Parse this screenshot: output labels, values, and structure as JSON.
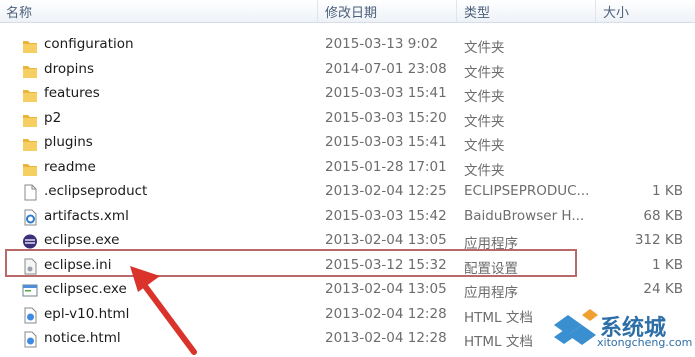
{
  "columns": {
    "name": "名称",
    "date": "修改日期",
    "type": "类型",
    "size": "大小"
  },
  "files": [
    {
      "name": "configuration",
      "date": "2015-03-13 9:02",
      "type": "文件夹",
      "size": "",
      "icon": "folder-icon"
    },
    {
      "name": "dropins",
      "date": "2014-07-01 23:08",
      "type": "文件夹",
      "size": "",
      "icon": "folder-icon"
    },
    {
      "name": "features",
      "date": "2015-03-03 15:41",
      "type": "文件夹",
      "size": "",
      "icon": "folder-icon"
    },
    {
      "name": "p2",
      "date": "2015-03-03 15:20",
      "type": "文件夹",
      "size": "",
      "icon": "folder-icon"
    },
    {
      "name": "plugins",
      "date": "2015-03-03 15:41",
      "type": "文件夹",
      "size": "",
      "icon": "folder-icon"
    },
    {
      "name": "readme",
      "date": "2015-01-28 17:01",
      "type": "文件夹",
      "size": "",
      "icon": "folder-icon"
    },
    {
      "name": ".eclipseproduct",
      "date": "2013-02-04 12:25",
      "type": "ECLIPSEPRODUC...",
      "size": "1 KB",
      "icon": "file-icon"
    },
    {
      "name": "artifacts.xml",
      "date": "2015-03-03 15:42",
      "type": "BaiduBrowser H...",
      "size": "68 KB",
      "icon": "xml-file-icon"
    },
    {
      "name": "eclipse.exe",
      "date": "2013-02-04 13:05",
      "type": "应用程序",
      "size": "312 KB",
      "icon": "eclipse-app-icon"
    },
    {
      "name": "eclipse.ini",
      "date": "2015-03-12 15:32",
      "type": "配置设置",
      "size": "1 KB",
      "icon": "ini-file-icon"
    },
    {
      "name": "eclipsec.exe",
      "date": "2013-02-04 13:05",
      "type": "应用程序",
      "size": "24 KB",
      "icon": "exe-file-icon"
    },
    {
      "name": "epl-v10.html",
      "date": "2013-02-04 12:28",
      "type": "HTML 文档",
      "size": "",
      "icon": "html-file-icon"
    },
    {
      "name": "notice.html",
      "date": "2013-02-04 12:28",
      "type": "HTML 文档",
      "size": "",
      "icon": "html-file-icon"
    }
  ],
  "watermark": {
    "brand": "系统城",
    "url": "xitongcheng.com"
  },
  "colors": {
    "folder": "#f2c14e",
    "highlight_border": "#b86a6a",
    "arrow": "#d9332b",
    "watermark": "#2d6ea7"
  }
}
